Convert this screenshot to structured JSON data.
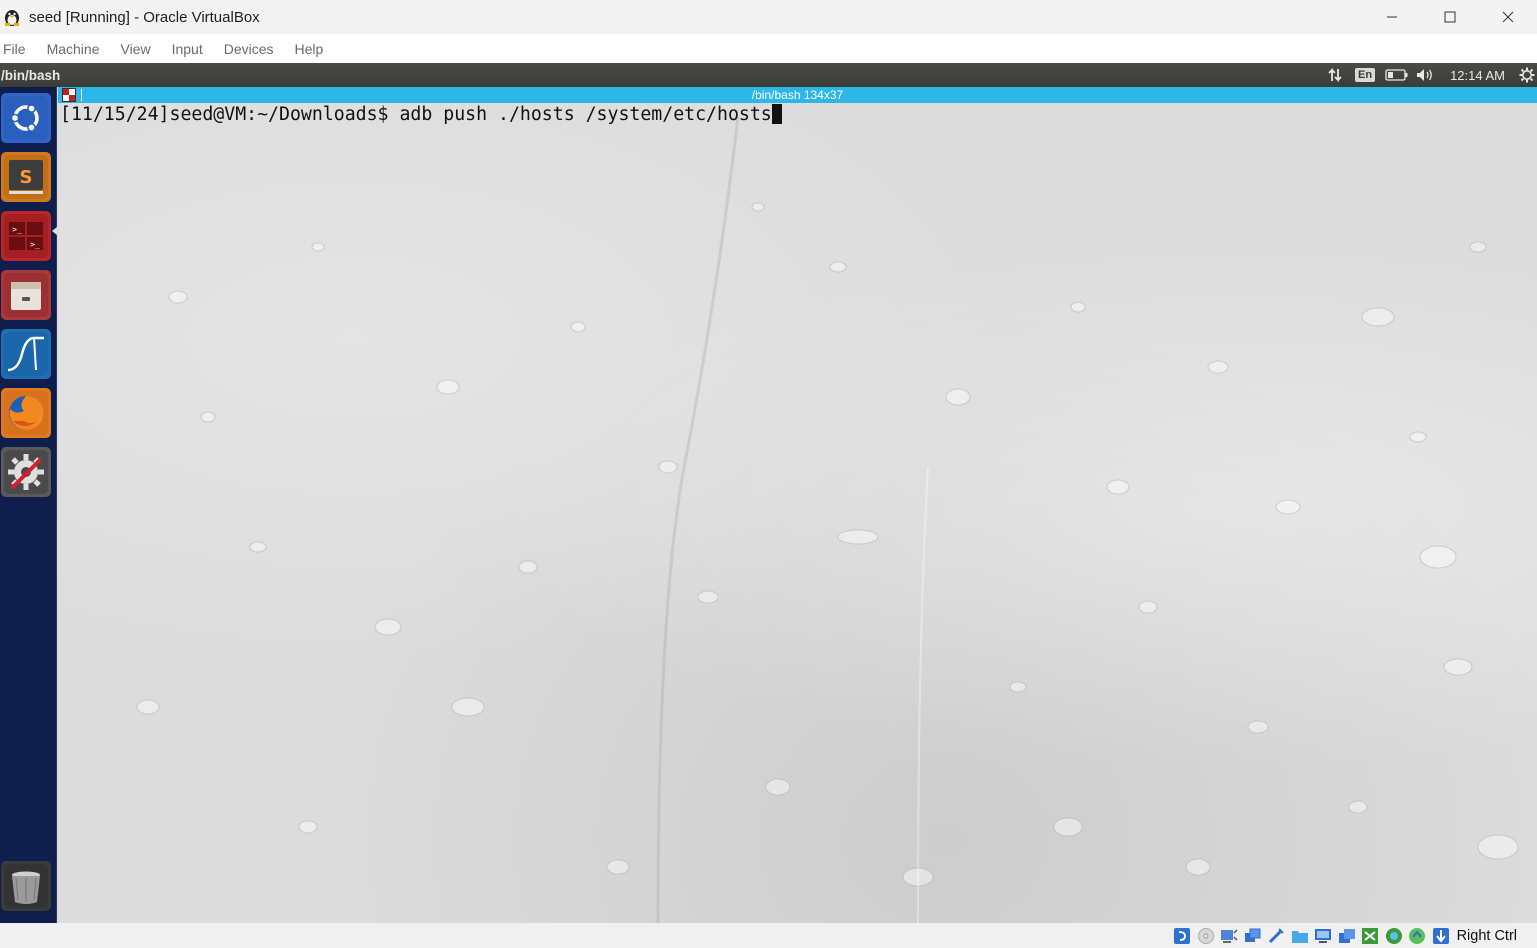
{
  "window": {
    "title": "seed [Running] - Oracle VirtualBox",
    "icon": "virtualbox-penguin-icon"
  },
  "menubar": {
    "items": [
      "File",
      "Machine",
      "View",
      "Input",
      "Devices",
      "Help"
    ]
  },
  "guest": {
    "topbar": {
      "window_title": "/bin/bash",
      "indicators": [
        "network-arrows-icon",
        "keyboard-layout",
        "battery-icon",
        "volume-icon",
        "clock",
        "settings-gear-icon"
      ],
      "keyboard_layout": "En",
      "clock": "12:14 AM"
    },
    "launcher": {
      "items": [
        {
          "name": "ubuntu-dash-icon"
        },
        {
          "name": "sublime-text-icon"
        },
        {
          "name": "terminal-icon",
          "active": true
        },
        {
          "name": "file-manager-icon"
        },
        {
          "name": "wireshark-icon"
        },
        {
          "name": "firefox-icon"
        },
        {
          "name": "system-settings-icon"
        }
      ],
      "trash": "trash-icon"
    },
    "terminal": {
      "title": "/bin/bash 134x37",
      "prompt": "[11/15/24]seed@VM:~/Downloads$ ",
      "command": "adb push ./hosts /system/etc/hosts"
    }
  },
  "statusbar": {
    "icons": [
      "optical-drive-icon",
      "floppy-icon",
      "audio-icon",
      "network-icon",
      "usb-icon",
      "shared-folders-icon",
      "display-icon",
      "recording-icon",
      "video-capture-icon",
      "cpu-icon",
      "mouse-integration-icon",
      "arrow-down-icon"
    ],
    "host_key": "Right Ctrl",
    "accent": "#2cb7e8"
  }
}
